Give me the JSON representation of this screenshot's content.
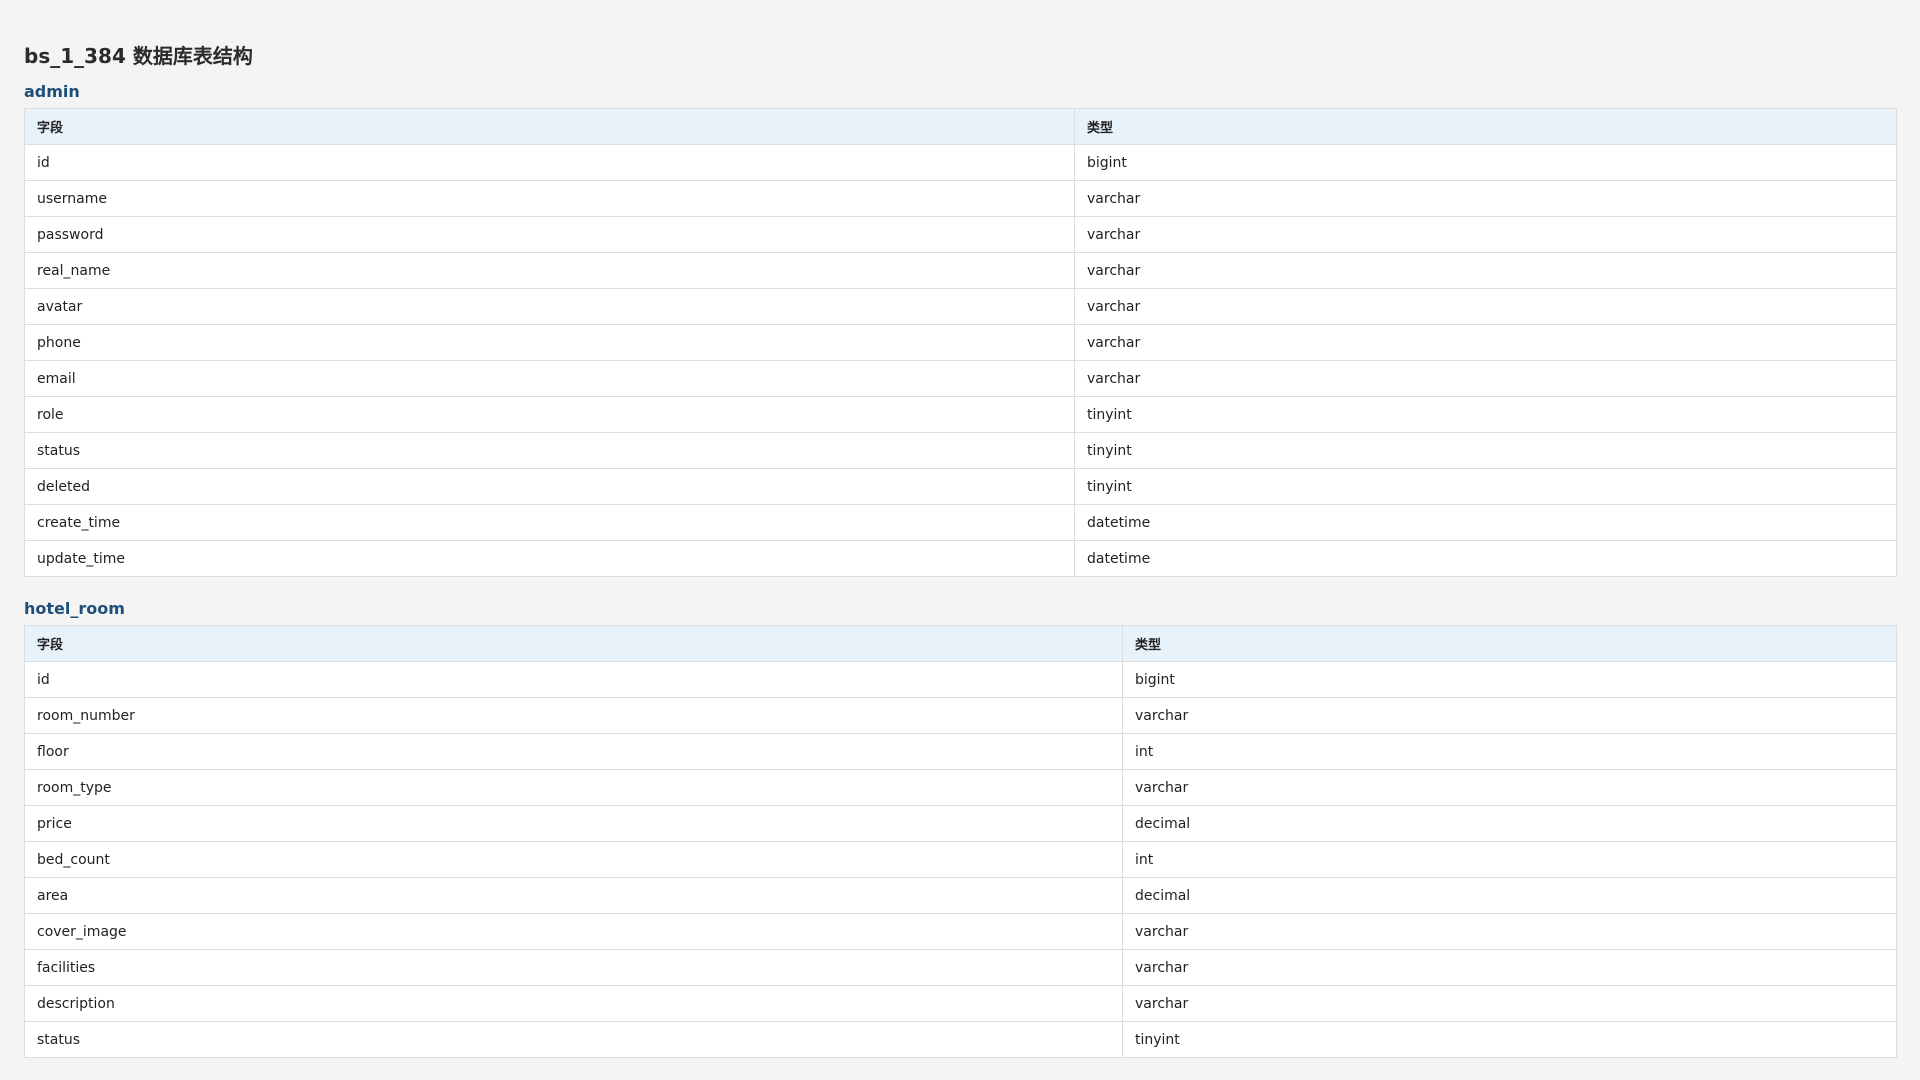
{
  "page": {
    "title": "bs_1_384 数据库表结构"
  },
  "tables": [
    {
      "name": "admin",
      "headers": {
        "field": "字段",
        "type": "类型"
      },
      "rows": [
        {
          "field": "id",
          "type": "bigint"
        },
        {
          "field": "username",
          "type": "varchar"
        },
        {
          "field": "password",
          "type": "varchar"
        },
        {
          "field": "real_name",
          "type": "varchar"
        },
        {
          "field": "avatar",
          "type": "varchar"
        },
        {
          "field": "phone",
          "type": "varchar"
        },
        {
          "field": "email",
          "type": "varchar"
        },
        {
          "field": "role",
          "type": "tinyint"
        },
        {
          "field": "status",
          "type": "tinyint"
        },
        {
          "field": "deleted",
          "type": "tinyint"
        },
        {
          "field": "create_time",
          "type": "datetime"
        },
        {
          "field": "update_time",
          "type": "datetime"
        }
      ]
    },
    {
      "name": "hotel_room",
      "headers": {
        "field": "字段",
        "type": "类型"
      },
      "rows": [
        {
          "field": "id",
          "type": "bigint"
        },
        {
          "field": "room_number",
          "type": "varchar"
        },
        {
          "field": "floor",
          "type": "int"
        },
        {
          "field": "room_type",
          "type": "varchar"
        },
        {
          "field": "price",
          "type": "decimal"
        },
        {
          "field": "bed_count",
          "type": "int"
        },
        {
          "field": "area",
          "type": "decimal"
        },
        {
          "field": "cover_image",
          "type": "varchar"
        },
        {
          "field": "facilities",
          "type": "varchar"
        },
        {
          "field": "description",
          "type": "varchar"
        },
        {
          "field": "status",
          "type": "tinyint"
        }
      ]
    }
  ]
}
